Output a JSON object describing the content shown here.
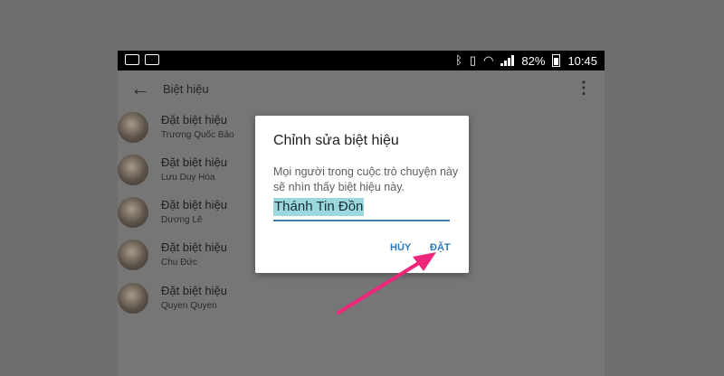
{
  "statusbar": {
    "battery": "82%",
    "time": "10:45"
  },
  "appbar": {
    "title": "Biệt hiệu"
  },
  "list": {
    "items": [
      {
        "title": "Đặt biệt hiệu",
        "name": "Trương Quốc Bảo"
      },
      {
        "title": "Đặt biệt hiệu",
        "name": "Lưu Duy Hòa"
      },
      {
        "title": "Đặt biệt hiệu",
        "name": "Dương Lê"
      },
      {
        "title": "Đặt biệt hiệu",
        "name": "Chu Đức"
      },
      {
        "title": "Đặt biệt hiệu",
        "name": "Quyen Quyen"
      }
    ]
  },
  "dialog": {
    "title": "Chỉnh sửa biệt hiệu",
    "message": "Mọi người trong cuộc trò chuyện này sẽ nhìn thấy biệt hiệu này.",
    "input_value": "Thánh Tin Đồn",
    "cancel_label": "HỦY",
    "confirm_label": "ĐẶT"
  },
  "colors": {
    "accent": "#2f78b8",
    "highlight": "#9ad8de",
    "annotation_arrow": "#f0267a"
  }
}
